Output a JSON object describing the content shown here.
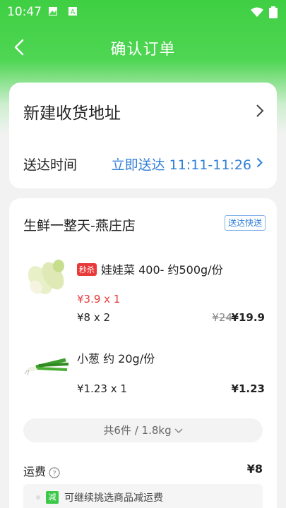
{
  "status_bar": {
    "time": "10:47"
  },
  "nav": {
    "title": "确认订单"
  },
  "address": {
    "title": "新建收货地址"
  },
  "delivery_time": {
    "label": "送达时间",
    "value": "立即送达 11:11-11:26"
  },
  "store": {
    "name": "生鲜一整天-燕庄店",
    "delivery_badge": "送达快送"
  },
  "products": [
    {
      "tag": "秒杀",
      "name": "娃娃菜 400- 约500g/份",
      "flash_price": "¥3.9 x 1",
      "regular_price": "¥8 x 2",
      "original_total": "¥24",
      "total": "¥19.9",
      "image_icon": "baby-cabbage-image"
    },
    {
      "name": "小葱 约 20g/份",
      "regular_price": "¥1.23 x 1",
      "total": "¥1.23",
      "image_icon": "scallion-image"
    }
  ],
  "summary": {
    "text": "共6件 / 1.8kg"
  },
  "shipping": {
    "label": "运费",
    "value": "¥8"
  },
  "tip": {
    "badge": "减",
    "text": "可继续挑选商品减运费"
  },
  "colors": {
    "brand_green": "#3fcf43",
    "link_blue": "#2f7fd8",
    "price_red": "#e83a3a"
  }
}
